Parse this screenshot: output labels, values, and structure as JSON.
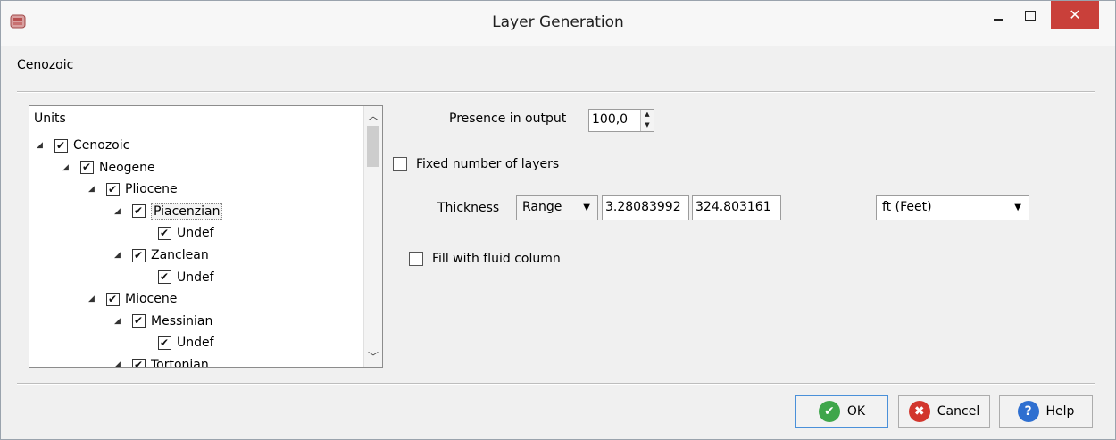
{
  "window": {
    "title": "Layer Generation",
    "close_glyph": "✕"
  },
  "section_label": "Cenozoic",
  "tree": {
    "header": "Units",
    "scroll_up_glyph": "︿",
    "scroll_down_glyph": "﹀",
    "items": [
      {
        "label": "Cenozoic",
        "checked": true,
        "expander": "◢",
        "selected": false
      },
      {
        "label": "Neogene",
        "checked": true,
        "expander": "◢",
        "selected": false
      },
      {
        "label": "Pliocene",
        "checked": true,
        "expander": "◢",
        "selected": false
      },
      {
        "label": "Piacenzian",
        "checked": true,
        "expander": "◢",
        "selected": true
      },
      {
        "label": "Undef",
        "checked": true,
        "expander": "",
        "selected": false
      },
      {
        "label": "Zanclean",
        "checked": true,
        "expander": "◢",
        "selected": false
      },
      {
        "label": "Undef",
        "checked": true,
        "expander": "",
        "selected": false
      },
      {
        "label": "Miocene",
        "checked": true,
        "expander": "◢",
        "selected": false
      },
      {
        "label": "Messinian",
        "checked": true,
        "expander": "◢",
        "selected": false
      },
      {
        "label": "Undef",
        "checked": true,
        "expander": "",
        "selected": false
      },
      {
        "label": "Tortonian",
        "checked": true,
        "expander": "◢",
        "selected": false
      }
    ]
  },
  "presence": {
    "label": "Presence in output",
    "value": "100,0",
    "up_glyph": "▲",
    "down_glyph": "▼"
  },
  "fixed_layers": {
    "label": "Fixed number of layers",
    "checked": false
  },
  "thickness": {
    "label": "Thickness",
    "mode": "Range",
    "min": "3.28083992",
    "max": "324.803161",
    "unit": "ft (Feet)",
    "arrow_glyph": "▼"
  },
  "fluid_column": {
    "label": "Fill with fluid column",
    "checked": false
  },
  "buttons": {
    "ok": "OK",
    "ok_glyph": "✔",
    "cancel": "Cancel",
    "cancel_glyph": "✖",
    "help": "Help",
    "help_glyph": "?"
  },
  "colors": {
    "close_button": "#c9403a",
    "ok_icon": "#3fa64b",
    "cancel_icon": "#d2362d",
    "help_icon": "#2e6fd0",
    "ok_focus_border": "#4a90d9"
  }
}
